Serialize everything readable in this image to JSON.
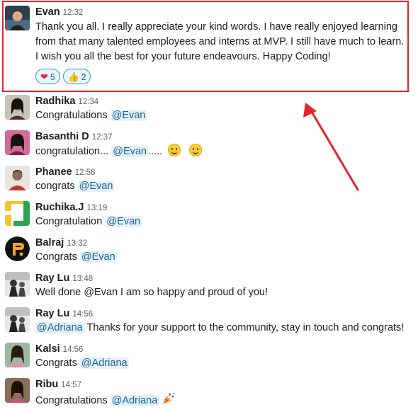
{
  "messages": [
    {
      "name": "Evan",
      "time": "12:32",
      "text": "Thank you all. I really appreciate your kind words. I have really enjoyed learning from that many talented employees and interns at MVP. I still have much to learn. I wish you all the best for your future endeavours. Happy Coding!",
      "reactions": [
        {
          "icon": "heart-icon",
          "count": "5"
        },
        {
          "icon": "thumbs-up-icon",
          "count": "2"
        }
      ]
    },
    {
      "name": "Radhika",
      "time": "12:34",
      "prefix": "Congratulations ",
      "mention": "@Evan",
      "suffix": ""
    },
    {
      "name": "Basanthi D",
      "time": "12:37",
      "prefix": "congratulation... ",
      "mention": "@Evan",
      "suffix": "....."
    },
    {
      "name": "Phanee",
      "time": "12:58",
      "prefix": "congrats ",
      "mention": "@Evan",
      "suffix": ""
    },
    {
      "name": "Ruchika.J",
      "time": "13:19",
      "prefix": "Congratulation ",
      "mention": "@Evan",
      "suffix": ""
    },
    {
      "name": "Balraj",
      "time": "13:32",
      "prefix": "Congrats ",
      "mention": "@Evan",
      "suffix": ""
    },
    {
      "name": "Ray Lu",
      "time": "13:48",
      "text": "Well done @Evan I am so happy and proud of you!"
    },
    {
      "name": "Ray Lu",
      "time": "14:56",
      "mention": "@Adriana",
      "suffix": " Thanks for your support to the community, stay in touch and congrats!"
    },
    {
      "name": "Kalsi",
      "time": "14:56",
      "prefix": "Congrats ",
      "mention": "@Adriana",
      "suffix": ""
    },
    {
      "name": "Ribu",
      "time": "14:57",
      "prefix": "Congratulations ",
      "mention": "@Adriana",
      "suffix": ""
    }
  ],
  "annotation": {
    "color": "#e2252b"
  },
  "colors": {
    "mention_bg": "#e8f1f8",
    "mention_text": "#1264a3"
  }
}
